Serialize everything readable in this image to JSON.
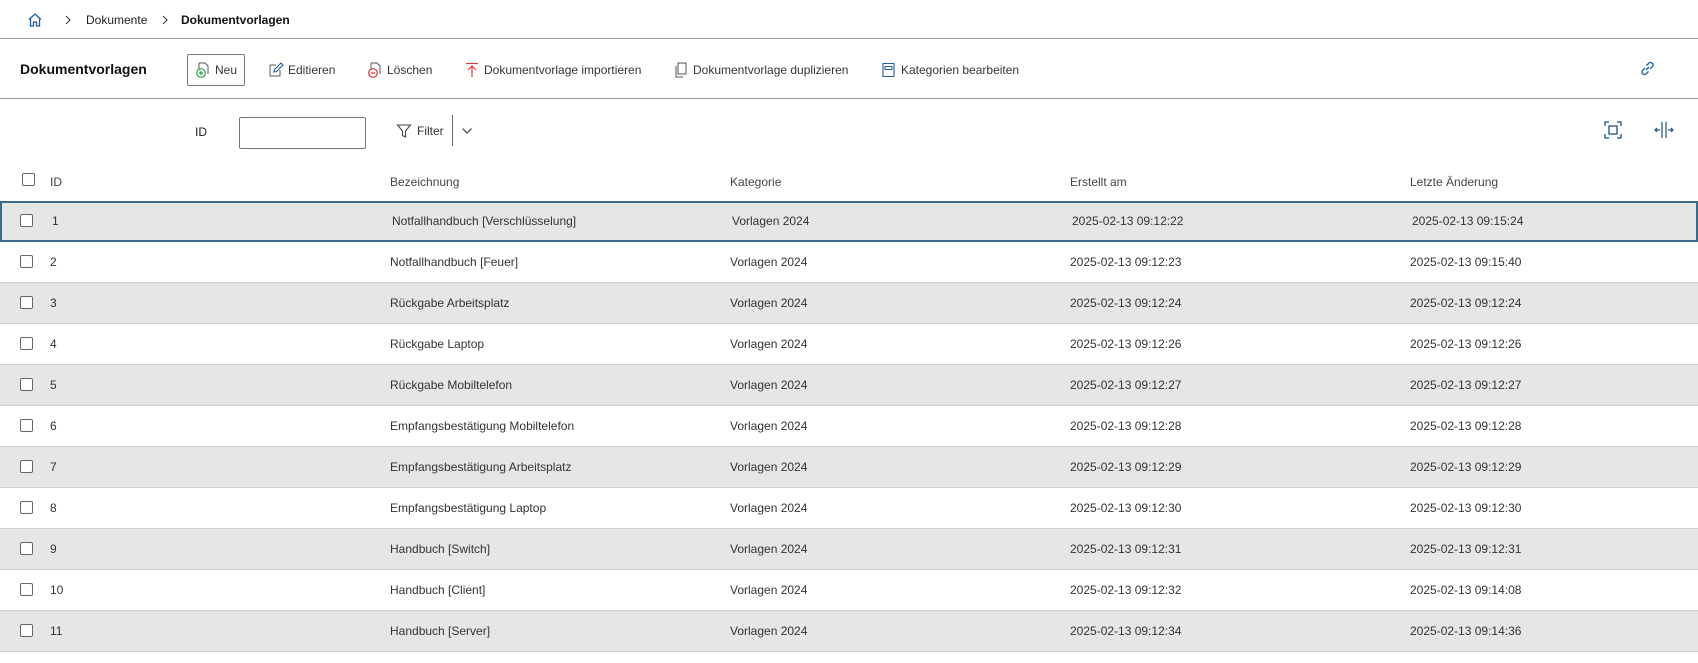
{
  "breadcrumb": {
    "home_icon": "home-icon",
    "items": [
      "Dokumente"
    ],
    "current": "Dokumentvorlagen"
  },
  "toolbar": {
    "title": "Dokumentvorlagen",
    "buttons": {
      "new": "Neu",
      "edit": "Editieren",
      "delete": "Löschen",
      "import": "Dokumentvorlage importieren",
      "duplicate": "Dokumentvorlage duplizieren",
      "categories": "Kategorien bearbeiten"
    },
    "icons": {
      "new": "document-add-icon",
      "edit": "edit-icon",
      "delete": "delete-icon",
      "import": "import-icon",
      "duplicate": "duplicate-icon",
      "categories": "category-icon",
      "link": "link-icon"
    }
  },
  "filter": {
    "id_label": "ID",
    "id_value": "",
    "filter_label": "Filter"
  },
  "table": {
    "columns": [
      "ID",
      "Bezeichnung",
      "Kategorie",
      "Erstellt am",
      "Letzte Änderung"
    ],
    "rows": [
      {
        "id": "1",
        "name": "Notfallhandbuch [Verschlüsselung]",
        "category": "Vorlagen 2024",
        "created": "2025-02-13 09:12:22",
        "modified": "2025-02-13 09:15:24"
      },
      {
        "id": "2",
        "name": "Notfallhandbuch [Feuer]",
        "category": "Vorlagen 2024",
        "created": "2025-02-13 09:12:23",
        "modified": "2025-02-13 09:15:40"
      },
      {
        "id": "3",
        "name": "Rückgabe Arbeitsplatz",
        "category": "Vorlagen 2024",
        "created": "2025-02-13 09:12:24",
        "modified": "2025-02-13 09:12:24"
      },
      {
        "id": "4",
        "name": "Rückgabe Laptop",
        "category": "Vorlagen 2024",
        "created": "2025-02-13 09:12:26",
        "modified": "2025-02-13 09:12:26"
      },
      {
        "id": "5",
        "name": "Rückgabe Mobiltelefon",
        "category": "Vorlagen 2024",
        "created": "2025-02-13 09:12:27",
        "modified": "2025-02-13 09:12:27"
      },
      {
        "id": "6",
        "name": "Empfangsbestätigung Mobiltelefon",
        "category": "Vorlagen 2024",
        "created": "2025-02-13 09:12:28",
        "modified": "2025-02-13 09:12:28"
      },
      {
        "id": "7",
        "name": "Empfangsbestätigung Arbeitsplatz",
        "category": "Vorlagen 2024",
        "created": "2025-02-13 09:12:29",
        "modified": "2025-02-13 09:12:29"
      },
      {
        "id": "8",
        "name": "Empfangsbestätigung Laptop",
        "category": "Vorlagen 2024",
        "created": "2025-02-13 09:12:30",
        "modified": "2025-02-13 09:12:30"
      },
      {
        "id": "9",
        "name": "Handbuch [Switch]",
        "category": "Vorlagen 2024",
        "created": "2025-02-13 09:12:31",
        "modified": "2025-02-13 09:12:31"
      },
      {
        "id": "10",
        "name": "Handbuch [Client]",
        "category": "Vorlagen 2024",
        "created": "2025-02-13 09:12:32",
        "modified": "2025-02-13 09:14:08"
      },
      {
        "id": "11",
        "name": "Handbuch [Server]",
        "category": "Vorlagen 2024",
        "created": "2025-02-13 09:12:34",
        "modified": "2025-02-13 09:14:36"
      }
    ]
  },
  "colors": {
    "accent": "#0f62a8",
    "row_alt": "#e5e6e6",
    "row_selected_border": "#3e6a8a",
    "import_icon": "#e03a3a",
    "delete_icon": "#d9342b",
    "new_icon": "#2f9e44"
  }
}
